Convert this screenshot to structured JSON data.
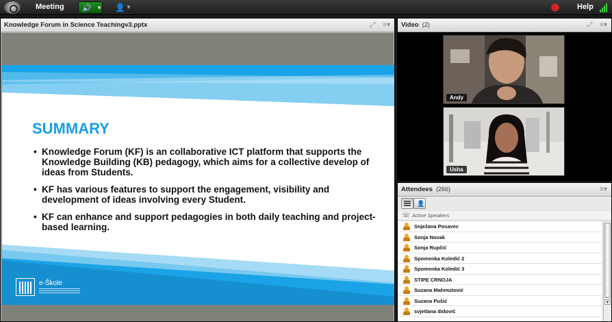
{
  "topbar": {
    "meeting_label": "Meeting",
    "help_label": "Help",
    "icons": [
      "adobe-connect-logo-icon",
      "speaker-icon",
      "webcam-person-icon",
      "record-dot-icon",
      "signal-strength-icon"
    ]
  },
  "share_pod": {
    "title": "Knowledge Forum in Science Teachingv3.pptx",
    "slide": {
      "heading": "SUMMARY",
      "bullets": [
        "Knowledge Forum (KF) is an collaborative ICT platform that supports the Knowledge Building (KB) pedagogy, which aims for a collective develop of ideas from Students.",
        "KF has various features to support the engagement, visibility and development of ideas involving every Student.",
        "KF can enhance and support pedagogies in both daily teaching and project-based learning."
      ],
      "logo_text": "e-Škole"
    }
  },
  "video_pod": {
    "title": "Video",
    "count": "(2)",
    "tiles": [
      {
        "name": "Andy"
      },
      {
        "name": "Usha"
      }
    ]
  },
  "attendees_pod": {
    "title": "Attendees",
    "count": "(266)",
    "active_speakers_label": "Active Speakers",
    "attendees": [
      "Snježana Posavec",
      "Sonja Novak",
      "Sonja Rupčić",
      "Spomenka Koledić 2",
      "Spomenka Koledić 3",
      "STIPE CRNOJA",
      "Suzana Mahmutović",
      "Suzana Pušić",
      "svjetlana didović"
    ]
  },
  "colors": {
    "slide_heading": "#1a9ee0",
    "slide_band": "#1aa3e6",
    "audio_active": "#1e8f1e",
    "record": "#e02020"
  }
}
